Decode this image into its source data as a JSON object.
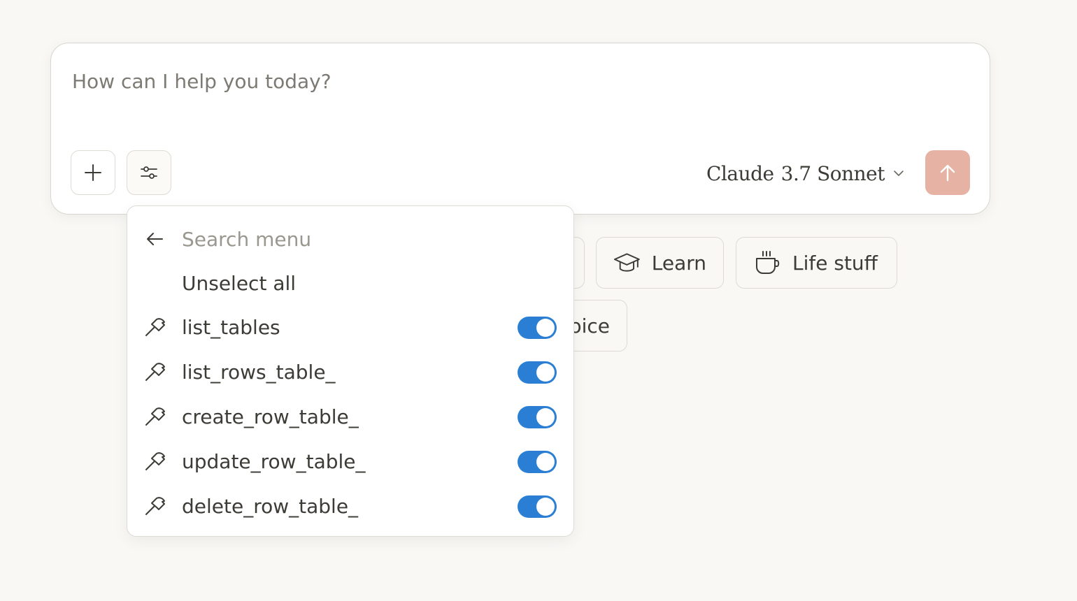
{
  "composer": {
    "placeholder": "How can I help you today?",
    "add_button_icon": "plus-icon",
    "tools_button_icon": "sliders-icon",
    "model_family": "Claude",
    "model_version": "3.7 Sonnet",
    "send_button_icon": "arrow-up-icon",
    "send_color": "#e6b2a4"
  },
  "chips": {
    "learn": "Learn",
    "life_stuff": "Life stuff",
    "partial_choice": "oice"
  },
  "tools_menu": {
    "search_placeholder": "Search menu",
    "unselect_all": "Unselect all",
    "tools": [
      {
        "name": "list_tables",
        "enabled": true
      },
      {
        "name": "list_rows_table_",
        "enabled": true
      },
      {
        "name": "create_row_table_",
        "enabled": true
      },
      {
        "name": "update_row_table_",
        "enabled": true
      },
      {
        "name": "delete_row_table_",
        "enabled": true
      }
    ],
    "toggle_color": "#2a7fd4"
  }
}
